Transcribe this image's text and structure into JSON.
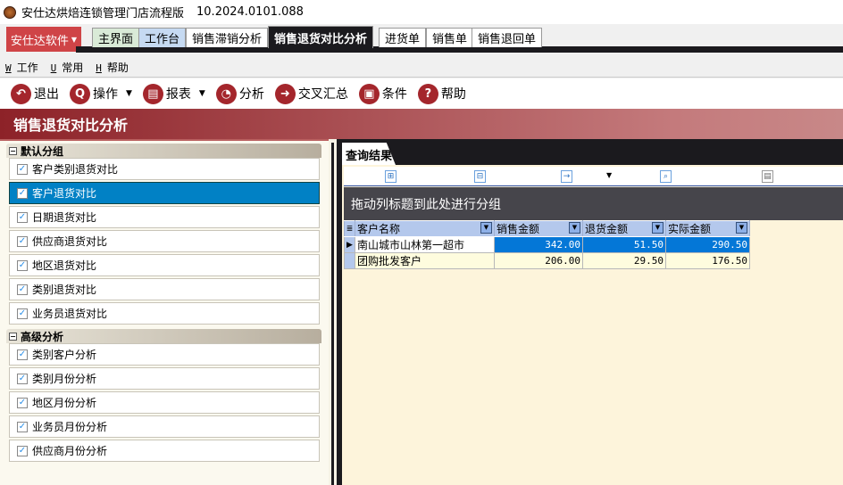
{
  "window": {
    "title": "安仕达烘焙连锁管理门店流程版",
    "version": "10.2024.0101.088"
  },
  "brand_menu": "安仕达软件",
  "tabs": [
    "主界面",
    "工作台",
    "销售滞销分析",
    "销售退货对比分析",
    "进货单",
    "销售单",
    "销售退回单"
  ],
  "menu": [
    {
      "key": "W",
      "label": "工作"
    },
    {
      "key": "U",
      "label": "常用"
    },
    {
      "key": "H",
      "label": "帮助"
    }
  ],
  "toolbar": [
    "退出",
    "操作",
    "报表",
    "分析",
    "交叉汇总",
    "条件",
    "帮助"
  ],
  "page_title": "销售退货对比分析",
  "groups": [
    {
      "title": "默认分组",
      "items": [
        "客户类别退货对比",
        "客户退货对比",
        "日期退货对比",
        "供应商退货对比",
        "地区退货对比",
        "类别退货对比",
        "业务员退货对比"
      ]
    },
    {
      "title": "高级分析",
      "items": [
        "类别客户分析",
        "类别月份分析",
        "地区月份分析",
        "业务员月份分析",
        "供应商月份分析"
      ]
    }
  ],
  "result_tab": "查询结果",
  "group_panel_hint": "拖动列标题到此处进行分组",
  "grid": {
    "columns": [
      "客户名称",
      "销售金额",
      "退货金额",
      "实际金额"
    ],
    "rows": [
      [
        "南山城市山林第一超市",
        "342.00",
        "51.50",
        "290.50"
      ],
      [
        "团购批发客户",
        "206.00",
        "29.50",
        "176.50"
      ]
    ]
  },
  "colors": {
    "accent": "#a4262c",
    "selected": "#0181c5"
  }
}
